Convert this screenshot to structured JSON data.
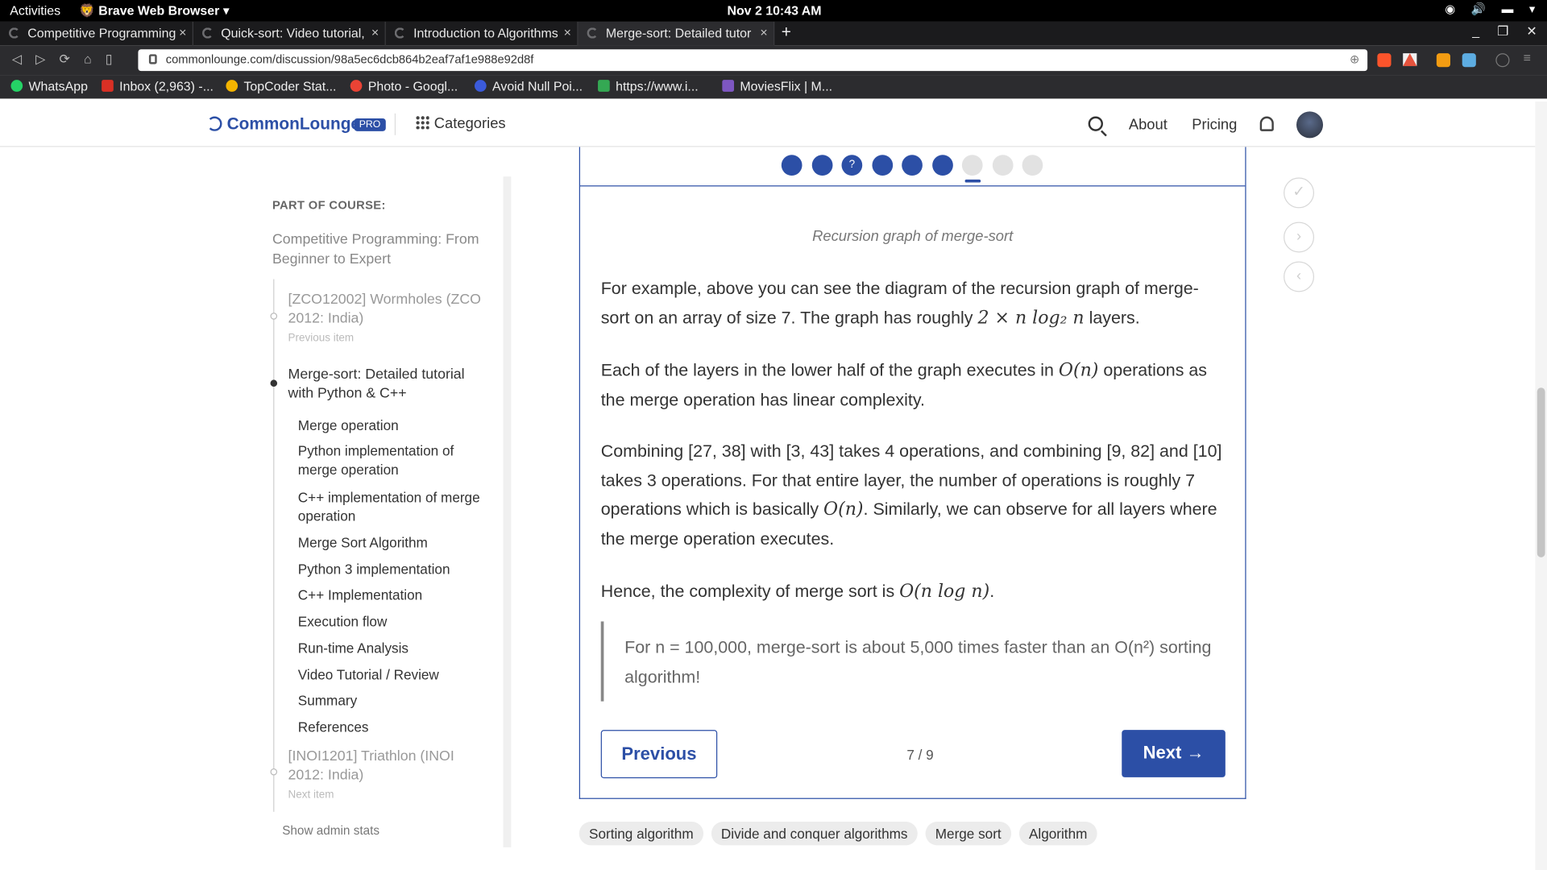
{
  "system": {
    "activities": "Activities",
    "app_menu": "Brave Web Browser",
    "clock": "Nov 2  10:43 AM"
  },
  "tabs": [
    {
      "title": "Competitive Programming"
    },
    {
      "title": "Quick-sort: Video tutorial,"
    },
    {
      "title": "Introduction to Algorithms"
    },
    {
      "title": "Merge-sort: Detailed tutor"
    }
  ],
  "address": {
    "url": "commonlounge.com/discussion/98a5ec6dcb864b2eaf7af1e988e92d8f"
  },
  "bookmarks": [
    {
      "label": "WhatsApp",
      "color": "#25d366"
    },
    {
      "label": "Inbox (2,963) -...",
      "color": "#d93025"
    },
    {
      "label": "TopCoder Stat...",
      "color": "#f4b400"
    },
    {
      "label": "Photo - Googl...",
      "color": "#ea4335"
    },
    {
      "label": "Avoid Null Poi...",
      "color": "#3b5bdb"
    },
    {
      "label": "https://www.i...",
      "color": "#34a853"
    },
    {
      "label": "MoviesFlix | M...",
      "color": "#7e57c2"
    }
  ],
  "header": {
    "brand": "CommonLounge",
    "badge": "PRO",
    "categories": "Categories",
    "about": "About",
    "pricing": "Pricing"
  },
  "sidebar": {
    "heading": "PART OF COURSE:",
    "course_title": "Competitive Programming: From Beginner to Expert",
    "previous": {
      "title": "[ZCO12002] Wormholes (ZCO 2012: India)",
      "sub": "Previous item"
    },
    "current": {
      "title": "Merge-sort: Detailed tutorial with Python & C++"
    },
    "toc": [
      "Merge operation",
      "Python implementation of merge operation",
      "C++ implementation of merge operation",
      "Merge Sort Algorithm",
      "Python 3 implementation",
      "C++ Implementation",
      "Execution flow",
      "Run-time Analysis",
      "Video Tutorial / Review",
      "Summary",
      "References"
    ],
    "next": {
      "title": "[INOI1201] Triathlon (INOI 2012: India)",
      "sub": "Next item"
    },
    "admin": "Show admin stats"
  },
  "progress": {
    "dots": [
      {
        "state": "done",
        "label": ""
      },
      {
        "state": "done",
        "label": ""
      },
      {
        "state": "done",
        "label": "?"
      },
      {
        "state": "done",
        "label": ""
      },
      {
        "state": "done",
        "label": ""
      },
      {
        "state": "done",
        "label": ""
      },
      {
        "state": "current",
        "label": ""
      },
      {
        "state": "todo",
        "label": ""
      },
      {
        "state": "todo",
        "label": ""
      }
    ],
    "current_index": 7,
    "total": 9
  },
  "content": {
    "caption": "Recursion graph of merge-sort",
    "p1_a": "For example, above you can see the diagram of the recursion graph of merge-sort on an array of size 7. The graph has roughly ",
    "p1_math": "2 × n log₂ n",
    "p1_b": " layers.",
    "p2_a": "Each of the layers in the lower half of the graph executes in ",
    "p2_math": "O(n)",
    "p2_b": " operations as the merge operation has linear complexity.",
    "p3_a": "Combining [27, 38] with [3, 43] takes 4 operations, and combining [9, 82] and [10] takes 3 operations. For that entire layer, the number of operations is roughly 7 operations which is basically ",
    "p3_math": "O(n)",
    "p3_b": ". Similarly, we can observe for all layers where the merge operation executes.",
    "p4_a": "Hence, the complexity of merge sort is ",
    "p4_math": "O(n log n)",
    "p4_b": ".",
    "quote": "For n = 100,000, merge-sort is about 5,000 times faster than an O(n²) sorting algorithm!"
  },
  "nav": {
    "previous": "Previous",
    "pager": "7 / 9",
    "next": "Next →"
  },
  "tags": [
    "Sorting algorithm",
    "Divide and conquer algorithms",
    "Merge sort",
    "Algorithm"
  ],
  "colors": {
    "accent": "#2c4fa6"
  }
}
